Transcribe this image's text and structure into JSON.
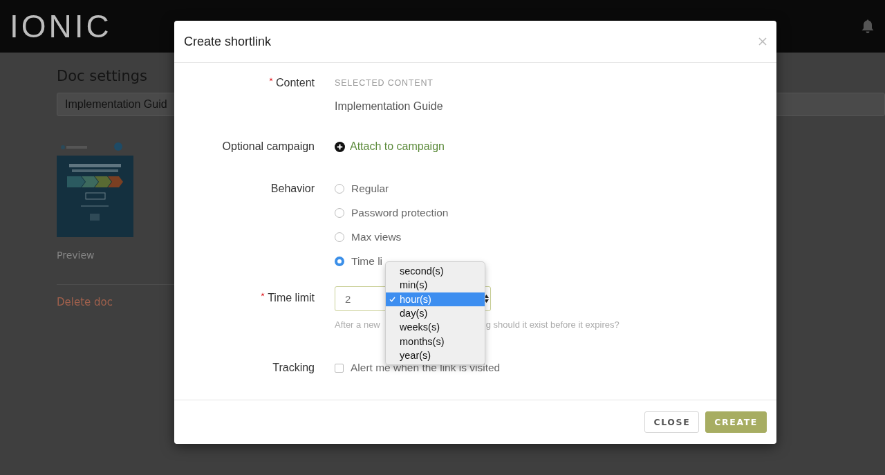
{
  "topbar": {
    "logo": "IONIC"
  },
  "page": {
    "title": "Doc settings",
    "name_field": {
      "value": "Implementation Guid"
    },
    "preview_link": "Preview",
    "delete_link": "Delete doc"
  },
  "dialog": {
    "title": "Create shortlink",
    "fields": [
      {
        "kind": "content",
        "label": "Content",
        "required": true,
        "caption": "SELECTED CONTENT",
        "value": "Implementation Guide"
      },
      {
        "kind": "link",
        "label": "Optional campaign",
        "required": false,
        "link": "Attach to campaign"
      },
      {
        "kind": "radios",
        "label": "Behavior",
        "required": false,
        "options": [
          {
            "label": "Regular",
            "selected": false
          },
          {
            "label": "Password protection",
            "selected": false
          },
          {
            "label": "Max views",
            "selected": false
          },
          {
            "label": "Time li",
            "selected": true
          }
        ]
      },
      {
        "kind": "duration",
        "label": "Time limit",
        "required": true,
        "value": "2",
        "help": [
          "After a new",
          "g should it exist before it expires?"
        ],
        "menu": [
          {
            "label": "second(s)",
            "selected": false
          },
          {
            "label": "min(s)",
            "selected": false
          },
          {
            "label": "hour(s)",
            "selected": true
          },
          {
            "label": "day(s)",
            "selected": false
          },
          {
            "label": "weeks(s)",
            "selected": false
          },
          {
            "label": "months(s)",
            "selected": false
          },
          {
            "label": "year(s)",
            "selected": false
          }
        ]
      },
      {
        "kind": "checkbox",
        "label": "Tracking",
        "required": false,
        "option": {
          "label": "Alert me when the link is visited",
          "checked": false
        }
      }
    ],
    "buttons": [
      {
        "label": "CLOSE",
        "kind": "secondary"
      },
      {
        "label": "CREATE",
        "kind": "primary"
      }
    ]
  }
}
